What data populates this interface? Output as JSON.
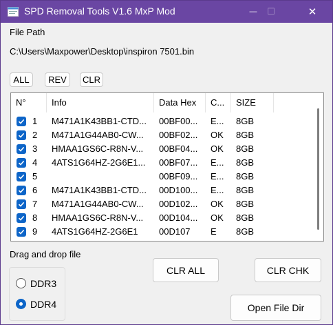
{
  "window": {
    "title": "SPD Removal Tools V1.6 MxP Mod",
    "minimize_glyph": "—",
    "maximize_glyph": "☐",
    "close_glyph": "✕",
    "accent_color": "#6a46a3"
  },
  "file": {
    "label": "File Path",
    "path": "C:\\Users\\Maxpower\\Desktop\\inspiron 7501.bin"
  },
  "toolbar": {
    "all_label": "ALL",
    "rev_label": "REV",
    "clr_label": "CLR"
  },
  "table": {
    "columns": [
      "N°",
      "Info",
      "Data Hex",
      "C...",
      "SIZE"
    ],
    "rows": [
      {
        "n": "1",
        "checked": true,
        "info": "M471A1K43BB1-CTD...",
        "hex": "00BF00...",
        "c": "E...",
        "size": "8GB"
      },
      {
        "n": "2",
        "checked": true,
        "info": "M471A1G44AB0-CW...",
        "hex": "00BF02...",
        "c": "OK",
        "size": "8GB"
      },
      {
        "n": "3",
        "checked": true,
        "info": "HMAA1GS6C-R8N-V...",
        "hex": "00BF04...",
        "c": "OK",
        "size": "8GB"
      },
      {
        "n": "4",
        "checked": true,
        "info": "4ATS1G64HZ-2G6E1...",
        "hex": "00BF07...",
        "c": "E...",
        "size": "8GB"
      },
      {
        "n": "5",
        "checked": true,
        "info": "",
        "hex": "00BF09...",
        "c": "E...",
        "size": "8GB"
      },
      {
        "n": "6",
        "checked": true,
        "info": "M471A1K43BB1-CTD...",
        "hex": "00D100...",
        "c": "E...",
        "size": "8GB"
      },
      {
        "n": "7",
        "checked": true,
        "info": "M471A1G44AB0-CW...",
        "hex": "00D102...",
        "c": "OK",
        "size": "8GB"
      },
      {
        "n": "8",
        "checked": true,
        "info": "HMAA1GS6C-R8N-V...",
        "hex": "00D104...",
        "c": "OK",
        "size": "8GB"
      },
      {
        "n": "9",
        "checked": true,
        "info": "4ATS1G64HZ-2G6E1",
        "hex": "00D107",
        "c": "E",
        "size": "8GB"
      }
    ]
  },
  "drop": {
    "label": "Drag and drop file"
  },
  "ddr": {
    "options": [
      "DDR3",
      "DDR4"
    ],
    "selected": "DDR4"
  },
  "actions": {
    "clr_all_label": "CLR ALL",
    "clr_chk_label": "CLR CHK",
    "open_dir_label": "Open File Dir"
  }
}
